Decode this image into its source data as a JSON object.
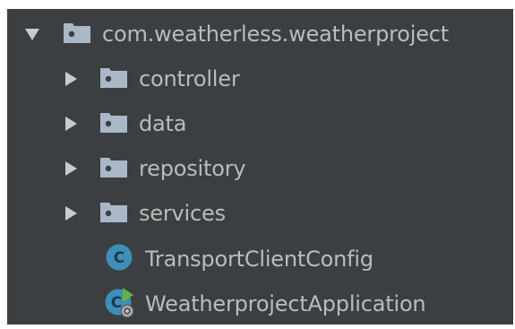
{
  "tree": {
    "root": {
      "label": "com.weatherless.weatherproject",
      "icon": "package-folder-icon",
      "expanded": true
    },
    "children": [
      {
        "label": "controller",
        "icon": "package-folder-icon",
        "expanded": false
      },
      {
        "label": "data",
        "icon": "package-folder-icon",
        "expanded": false
      },
      {
        "label": "repository",
        "icon": "package-folder-icon",
        "expanded": false
      },
      {
        "label": "services",
        "icon": "package-folder-icon",
        "expanded": false
      },
      {
        "label": "TransportClientConfig",
        "icon": "java-class-icon"
      },
      {
        "label": "WeatherprojectApplication",
        "icon": "spring-boot-class-icon"
      }
    ]
  },
  "colors": {
    "background": "#3c3f41",
    "text": "#bbbbbb",
    "folder": "#a9b7c6",
    "class_badge": "#3d8fb8",
    "spring_arrow": "#62b543",
    "arrow": "#c9cbcd"
  }
}
